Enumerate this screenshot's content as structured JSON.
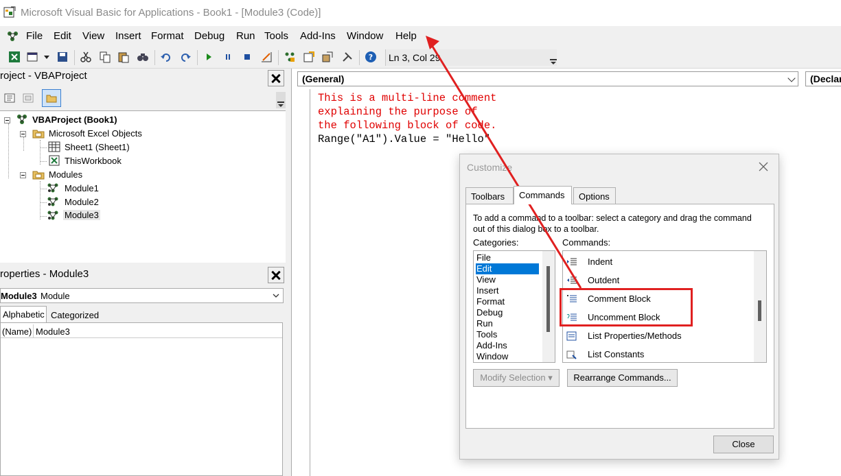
{
  "window": {
    "title": "Microsoft Visual Basic for Applications - Book1 - [Module3 (Code)]"
  },
  "menu": [
    "File",
    "Edit",
    "View",
    "Insert",
    "Format",
    "Debug",
    "Run",
    "Tools",
    "Add-Ins",
    "Window",
    "Help"
  ],
  "toolbar": {
    "position": "Ln 3, Col 29"
  },
  "project": {
    "title": "roject - VBAProject",
    "root": "VBAProject (Book1)",
    "excel_objects": "Microsoft Excel Objects",
    "sheet1": "Sheet1 (Sheet1)",
    "workbook": "ThisWorkbook",
    "modules": "Modules",
    "module_items": [
      "Module1",
      "Module2",
      "Module3"
    ]
  },
  "properties": {
    "title": "roperties - Module3",
    "object_name": "Module3",
    "object_type": "Module",
    "tabs": [
      "Alphabetic",
      "Categorized"
    ],
    "row_name": "(Name)",
    "row_value": "Module3"
  },
  "code": {
    "object_combo": "(General)",
    "proc_combo": "(Declara",
    "lines": [
      "This is a multi-line comment",
      "explaining the purpose of",
      "the following block of code.",
      "Range(\"A1\").Value = \"Hello\""
    ]
  },
  "dialog": {
    "title": "Customize",
    "tabs": [
      "Toolbars",
      "Commands",
      "Options"
    ],
    "description": [
      "To add a command to a toolbar: select a category and drag the command",
      "out of this dialog box to a toolbar."
    ],
    "categories_label": "Categories:",
    "commands_label": "Commands:",
    "categories": [
      "File",
      "Edit",
      "View",
      "Insert",
      "Format",
      "Debug",
      "Run",
      "Tools",
      "Add-Ins",
      "Window"
    ],
    "selected_category": "Edit",
    "commands": [
      "Indent",
      "Outdent",
      "Comment Block",
      "Uncomment Block",
      "List Properties/Methods",
      "List Constants"
    ],
    "modify_button": "Modify Selection ▾",
    "rearrange_button": "Rearrange Commands...",
    "close_button": "Close"
  },
  "colors": {
    "comment": "#e00000",
    "selection": "#0078d7",
    "annotation": "#e02020"
  }
}
